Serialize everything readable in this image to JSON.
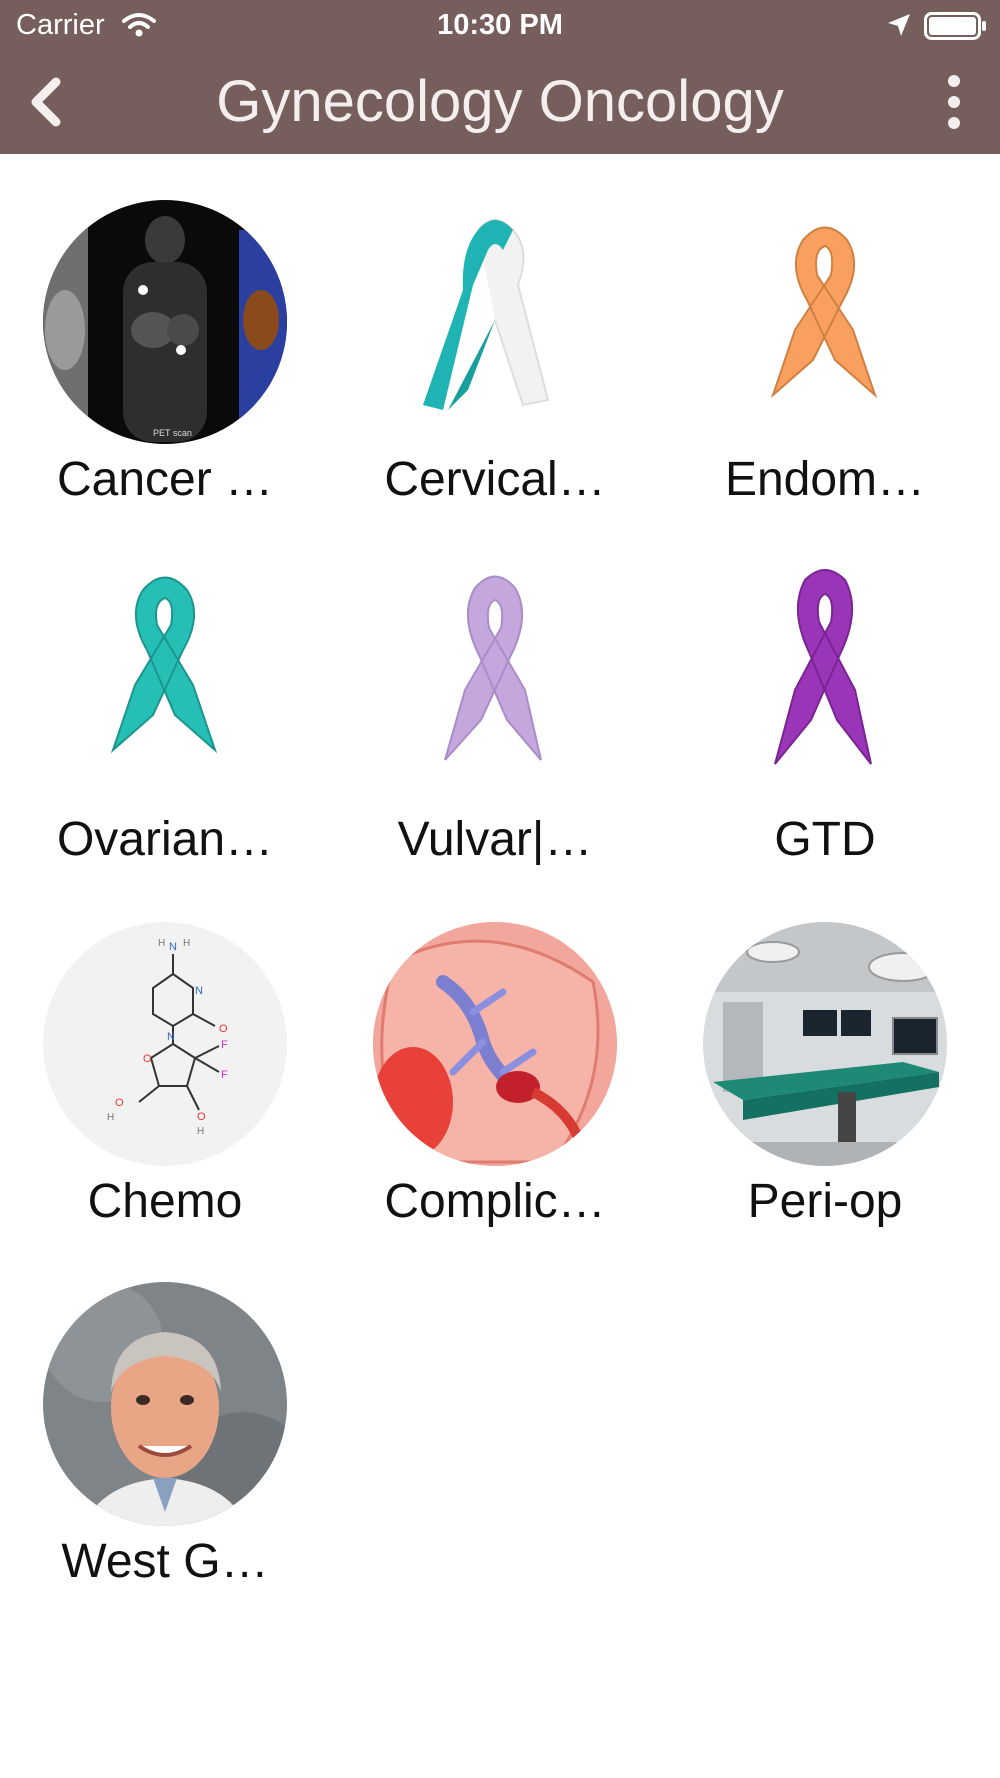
{
  "status_bar": {
    "carrier": "Carrier",
    "time": "10:30 PM"
  },
  "nav": {
    "title": "Gynecology Oncology",
    "back_icon": "chevron-left-icon",
    "menu_icon": "more-vertical-icon"
  },
  "colors": {
    "nav_background": "#755e5b",
    "title_text": "#f4efee",
    "page_background": "#ffffff"
  },
  "items": [
    {
      "label": "Cancer …",
      "image": "pet-scan-image"
    },
    {
      "label": "Cervical…",
      "image": "teal-white-ribbon",
      "ribbon_colors": [
        "#1fb3b3",
        "#f2f2f2"
      ]
    },
    {
      "label": "Endom…",
      "image": "peach-ribbon",
      "ribbon_colors": [
        "#f9a061"
      ]
    },
    {
      "label": "Ovarian…",
      "image": "teal-ribbon",
      "ribbon_colors": [
        "#25bfb6"
      ]
    },
    {
      "label": "Vulvar|…",
      "image": "lavender-ribbon",
      "ribbon_colors": [
        "#c3a7dd"
      ]
    },
    {
      "label": "GTD",
      "image": "purple-ribbon",
      "ribbon_colors": [
        "#9a35b8"
      ]
    },
    {
      "label": "Chemo",
      "image": "gemcitabine-molecule"
    },
    {
      "label": "Complic…",
      "image": "lung-embolism-illustration"
    },
    {
      "label": "Peri-op",
      "image": "operating-room-photo"
    },
    {
      "label": "West G…",
      "image": "doctor-portrait"
    }
  ]
}
